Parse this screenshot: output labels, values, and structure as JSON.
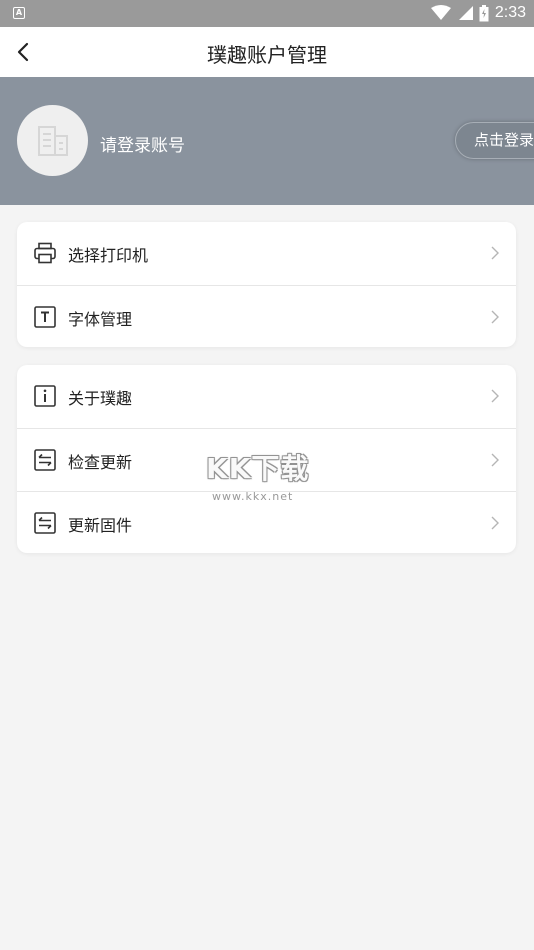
{
  "status_bar": {
    "notification_icon_letter": "A",
    "time": "2:33",
    "icons": [
      "wifi-icon",
      "signal-icon",
      "battery-icon"
    ]
  },
  "app_bar": {
    "title": "璞趣账户管理",
    "back_icon": "chevron-left-icon"
  },
  "profile": {
    "login_hint": "请登录账号",
    "login_button": "点击登录",
    "avatar_icon": "building-icon",
    "background_color": "#8a939e"
  },
  "menu_groups": [
    {
      "items": [
        {
          "label": "选择打印机",
          "icon": "printer-icon"
        },
        {
          "label": "字体管理",
          "icon": "font-icon"
        }
      ]
    },
    {
      "items": [
        {
          "label": "关于璞趣",
          "icon": "info-icon"
        },
        {
          "label": "检查更新",
          "icon": "update-icon"
        },
        {
          "label": "更新固件",
          "icon": "firmware-update-icon"
        }
      ]
    }
  ],
  "watermark": {
    "brand": "KK下载",
    "url": "www.kkx.net"
  }
}
